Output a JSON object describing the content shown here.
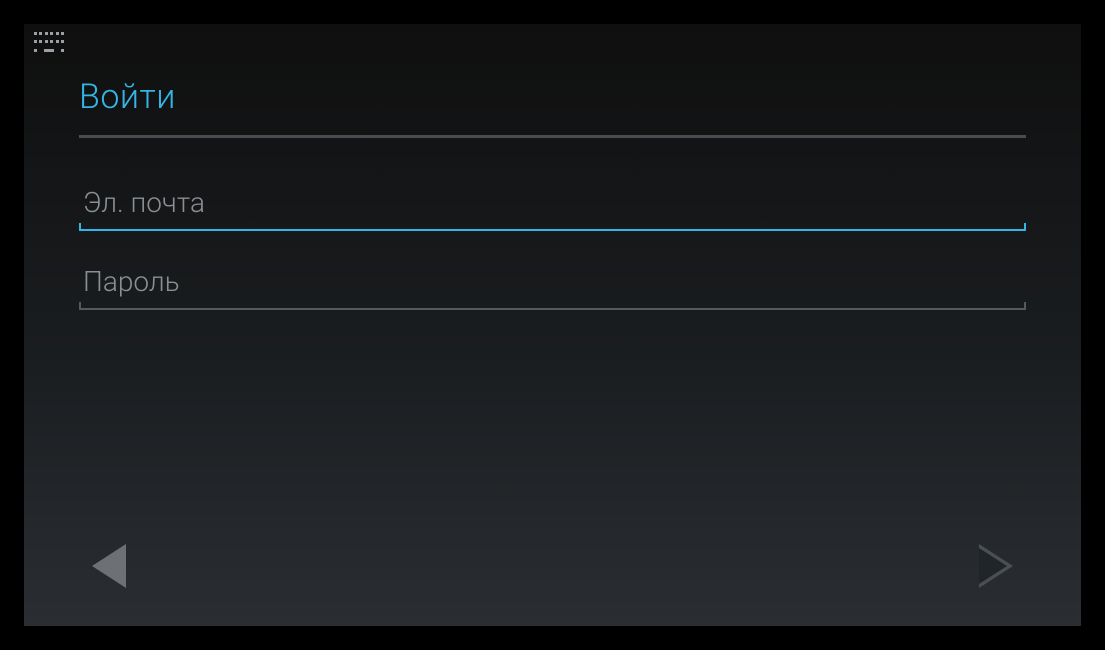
{
  "colors": {
    "accent": "#33b5e5",
    "placeholder": "#8a8f93",
    "divider": "#4a4d50",
    "nav_icon_active": "#6d7176",
    "nav_icon_inactive": "#4b4f53"
  },
  "status_bar": {
    "keyboard_icon": "keyboard"
  },
  "login": {
    "title": "Войти",
    "email": {
      "placeholder": "Эл. почта",
      "value": "",
      "focused": true
    },
    "password": {
      "placeholder": "Пароль",
      "value": "",
      "focused": false
    }
  },
  "navigation": {
    "back": "back",
    "forward": "forward"
  }
}
